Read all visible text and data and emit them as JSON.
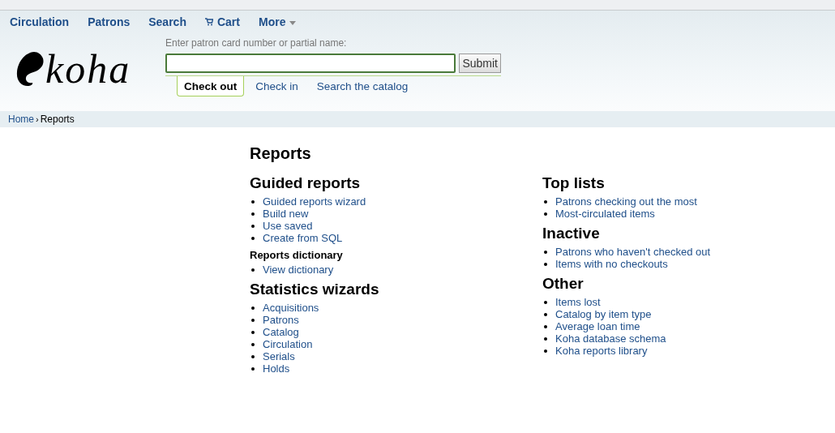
{
  "nav": [
    {
      "label": "Circulation",
      "kind": "plain"
    },
    {
      "label": "Patrons",
      "kind": "plain"
    },
    {
      "label": "Search",
      "kind": "plain"
    },
    {
      "label": "Cart",
      "kind": "cart"
    },
    {
      "label": "More",
      "kind": "menu"
    }
  ],
  "logo": {
    "text": "koha"
  },
  "patron_search": {
    "label": "Enter patron card number or partial name:",
    "button": "Submit"
  },
  "tabs": [
    {
      "label": "Check out",
      "selected": true
    },
    {
      "label": "Check in",
      "selected": false
    },
    {
      "label": "Search the catalog",
      "selected": false
    }
  ],
  "breadcrumbs": [
    {
      "label": "Home",
      "kind": "link"
    },
    {
      "label": "›",
      "kind": "separator"
    },
    {
      "label": "Reports",
      "kind": "current"
    }
  ],
  "title": "Reports",
  "columns": [
    {
      "sections": [
        {
          "kind": "major",
          "heading": "Guided reports",
          "links": [
            "Guided reports wizard",
            "Build new",
            "Use saved",
            "Create from SQL"
          ]
        },
        {
          "kind": "minor",
          "heading": "Reports dictionary",
          "links": [
            "View dictionary"
          ]
        },
        {
          "kind": "major",
          "heading": "Statistics wizards",
          "links": [
            "Acquisitions",
            "Patrons",
            "Catalog",
            "Circulation",
            "Serials",
            "Holds"
          ]
        }
      ]
    },
    {
      "sections": [
        {
          "kind": "major",
          "heading": "Top lists",
          "links": [
            "Patrons checking out the most",
            "Most-circulated items"
          ]
        },
        {
          "kind": "major",
          "heading": "Inactive",
          "links": [
            "Patrons who haven't checked out",
            "Items with no checkouts"
          ]
        },
        {
          "kind": "major",
          "heading": "Other",
          "links": [
            "Items lost",
            "Catalog by item type",
            "Average loan time",
            "Koha database schema",
            "Koha reports library"
          ]
        }
      ]
    }
  ]
}
